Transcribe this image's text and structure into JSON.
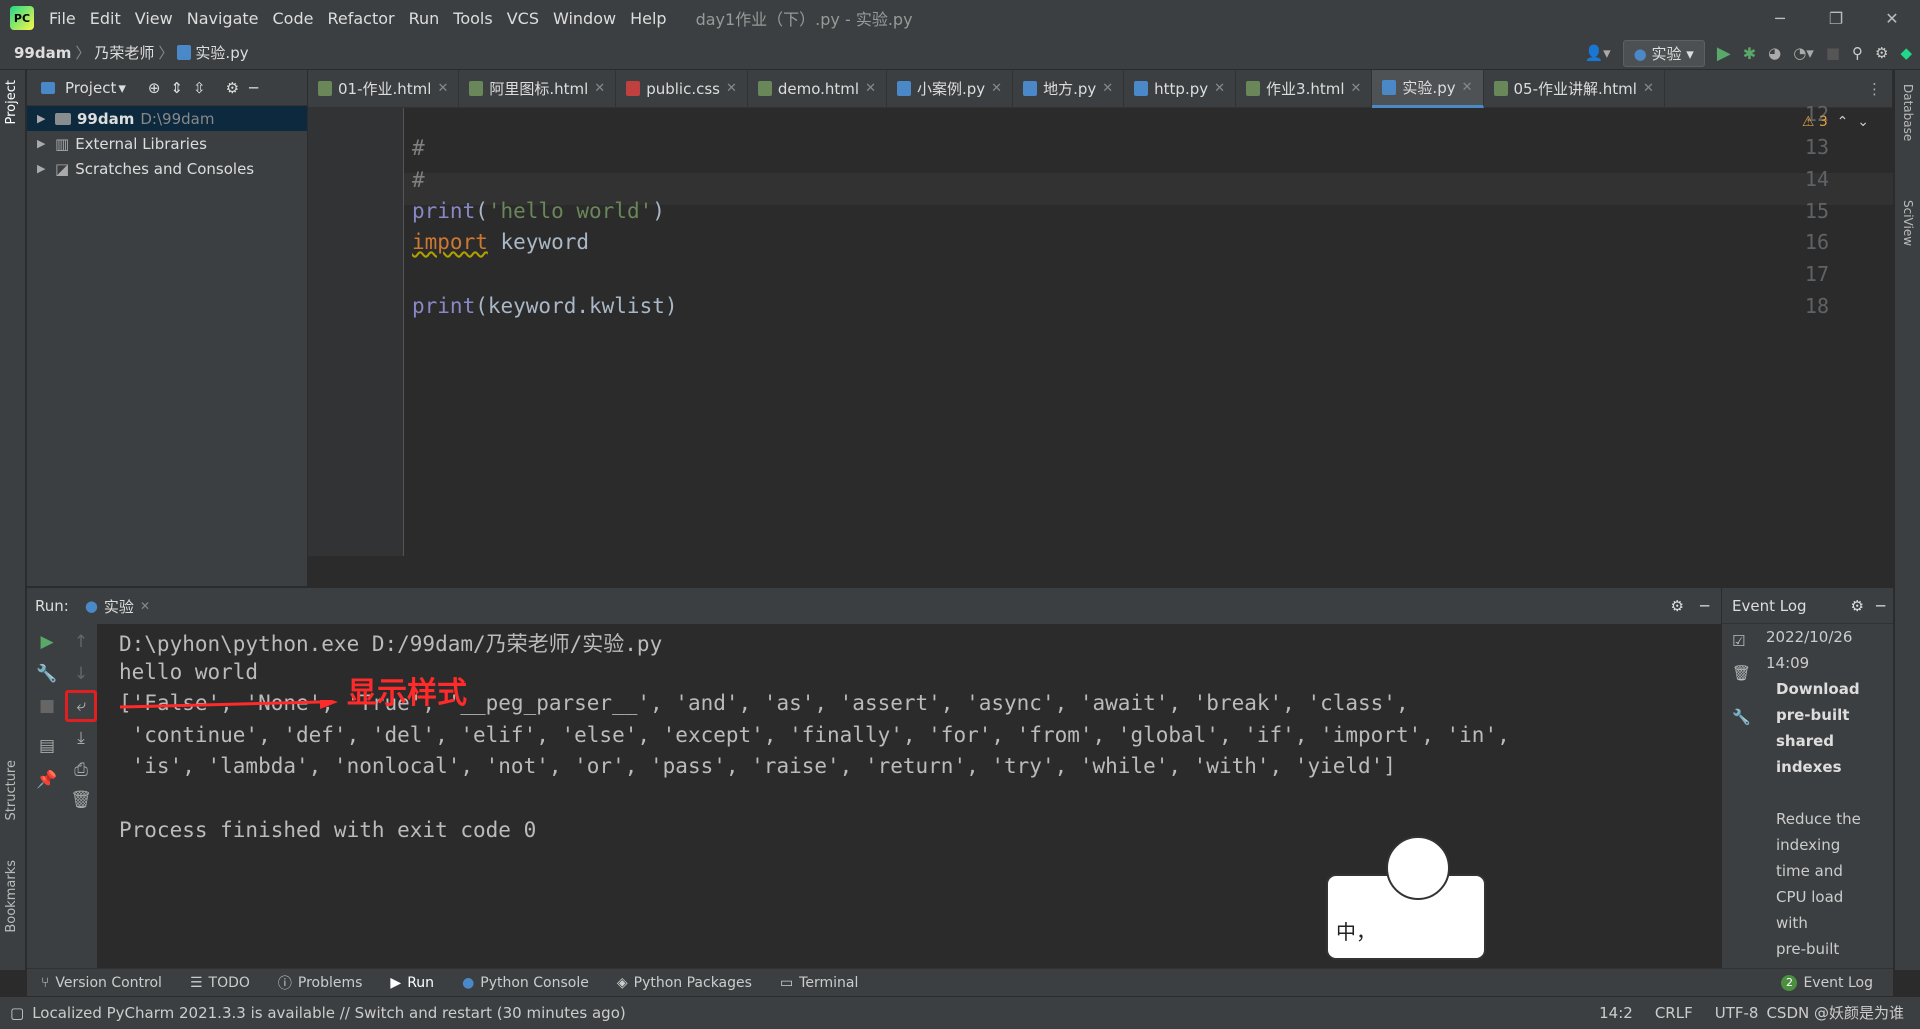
{
  "menubar": {
    "items": [
      "File",
      "Edit",
      "View",
      "Navigate",
      "Code",
      "Refactor",
      "Run",
      "Tools",
      "VCS",
      "Window",
      "Help"
    ],
    "title": "day1作业（下）.py - 实验.py"
  },
  "breadcrumb": {
    "root": "99dam",
    "folder": "乃荣老师",
    "file": "实验.py"
  },
  "run_config": "实验",
  "project": {
    "header": "Project",
    "rows": [
      {
        "label": "99dam",
        "path": "D:\\99dam"
      },
      {
        "label": "External Libraries"
      },
      {
        "label": "Scratches and Consoles"
      }
    ]
  },
  "tabs": [
    "01-作业.html",
    "阿里图标.html",
    "public.css",
    "demo.html",
    "小案例.py",
    "地方.py",
    "http.py",
    "作业3.html",
    "实验.py",
    "05-作业讲解.html"
  ],
  "editor": {
    "warnings": "⚠ 3",
    "line_numbers": [
      "12",
      "13",
      "14",
      "15",
      "16",
      "17",
      "18"
    ],
    "lines": {
      "l13": "#",
      "l14": "#",
      "l15a": "print",
      "l15b": "(",
      "l15c": "'hello world'",
      "l15d": ")",
      "l16a": "import",
      "l16b": " keyword",
      "l18a": "print",
      "l18b": "(keyword.kwlist)"
    }
  },
  "run": {
    "label": "Run:",
    "tab": "实验",
    "output": [
      "D:\\pyhon\\python.exe D:/99dam/乃荣老师/实验.py",
      "hello world",
      "['False', 'None', 'True', '__peg_parser__', 'and', 'as', 'assert', 'async', 'await', 'break', 'class',",
      " 'continue', 'def', 'del', 'elif', 'else', 'except', 'finally', 'for', 'from', 'global', 'if', 'import', 'in',",
      " 'is', 'lambda', 'nonlocal', 'not', 'or', 'pass', 'raise', 'return', 'try', 'while', 'with', 'yield']",
      "",
      "Process finished with exit code 0"
    ],
    "annotation": "显示样式"
  },
  "eventlog": {
    "title": "Event Log",
    "date": "2022/10/26",
    "time": "14:09",
    "heading": [
      "Download",
      "pre-built",
      "shared",
      "indexes"
    ],
    "body": [
      "Reduce the",
      " indexing",
      "time and",
      "CPU load",
      "with",
      "pre-built"
    ]
  },
  "sticker": {
    "text": "中，"
  },
  "bottom_tabs": [
    "Version Control",
    "TODO",
    "Problems",
    "Run",
    "Python Console",
    "Python Packages",
    "Terminal"
  ],
  "event_log_btn": "Event Log",
  "event_log_count": "2",
  "left_tools": [
    "Project",
    "Structure",
    "Bookmarks"
  ],
  "right_tools": [
    "Database",
    "SciView"
  ],
  "status": {
    "message": "Localized PyCharm 2021.3.3 is available // Switch and restart (30 minutes ago)",
    "pos": "14:2",
    "eol": "CRLF",
    "enc": "UTF-8",
    "watermark": "CSDN @妖颜是为谁"
  }
}
